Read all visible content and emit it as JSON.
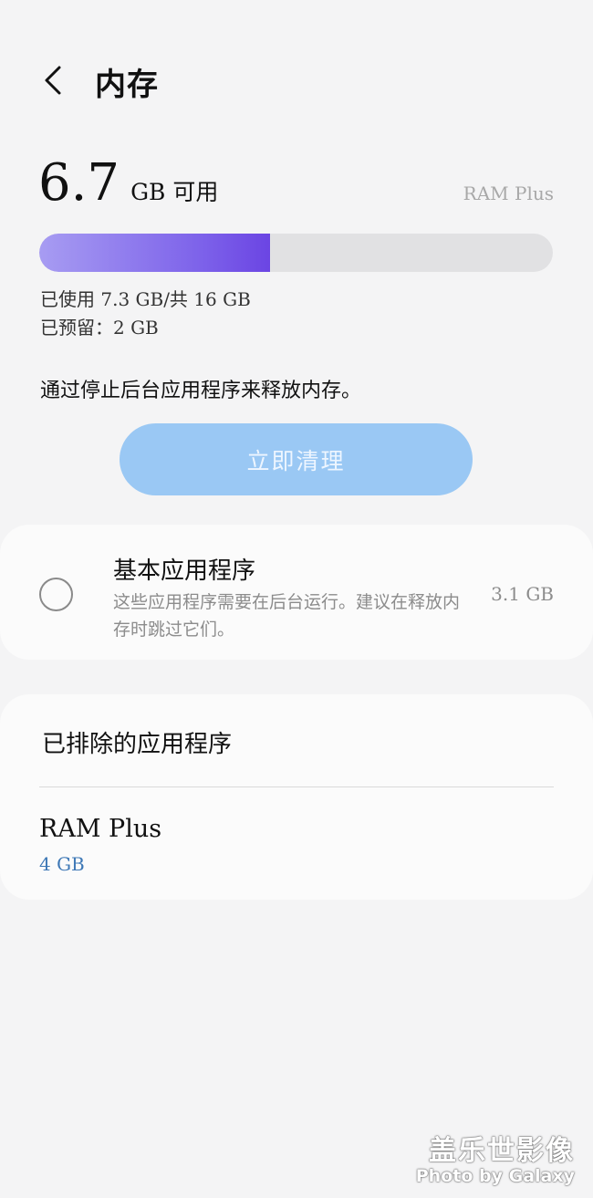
{
  "header": {
    "title": "内存"
  },
  "summary": {
    "available_value": "6.7",
    "available_unit": "GB 可用",
    "ram_plus_link": "RAM Plus",
    "usage_fraction": 0.45,
    "used_text": "已使用 7.3 GB/共 16 GB",
    "reserved_text": "已预留：2 GB",
    "description": "通过停止后台应用程序来释放内存。",
    "clean_button_label": "立即清理"
  },
  "basic_apps": {
    "title": "基本应用程序",
    "description": "这些应用程序需要在后台运行。建议在释放内存时跳过它们。",
    "size": "3.1 GB"
  },
  "excluded_apps": {
    "title": "已排除的应用程序",
    "items": [
      {
        "name": "RAM Plus",
        "value": "4 GB"
      }
    ]
  },
  "watermark": {
    "title": "盖乐世影像",
    "subtitle": "Photo by Galaxy"
  },
  "colors": {
    "accent_fill": "#7d62ea",
    "button": "#9ac8f4",
    "link_value": "#3e78b6"
  }
}
